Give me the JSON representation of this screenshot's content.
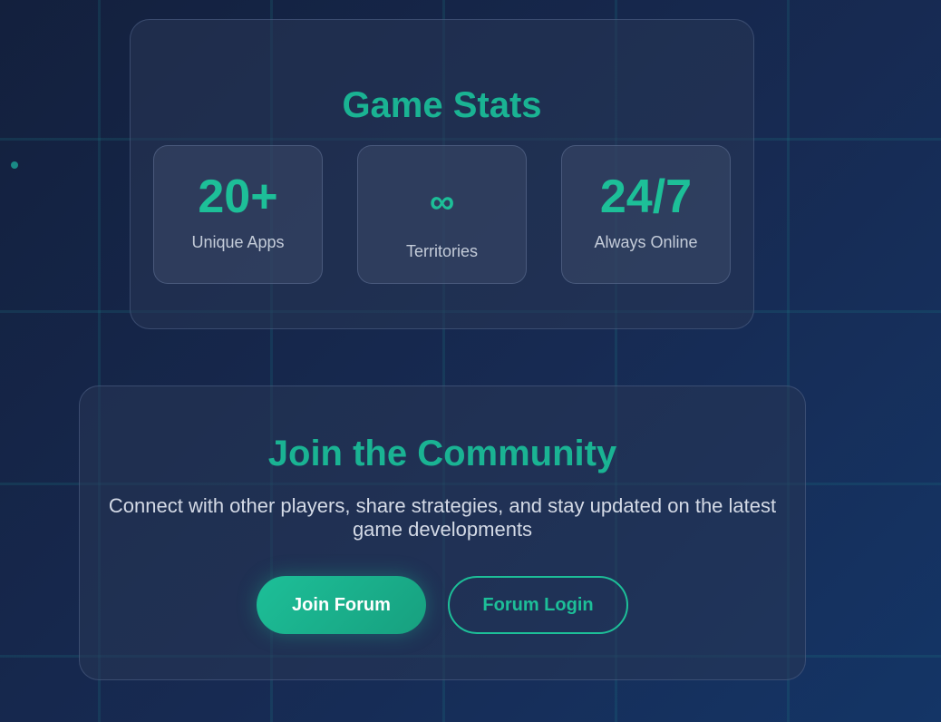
{
  "stats": {
    "title": "Game Stats",
    "items": [
      {
        "value": "20+",
        "label": "Unique Apps"
      },
      {
        "value": "∞",
        "label": "Territories"
      },
      {
        "value": "24/7",
        "label": "Always Online"
      }
    ]
  },
  "community": {
    "title": "Join the Community",
    "description": "Connect with other players, share strategies, and stay updated on the latest game developments",
    "join_button": "Join Forum",
    "login_button": "Forum Login"
  },
  "colors": {
    "accent": "#1dbf98",
    "background": "#172a52"
  }
}
